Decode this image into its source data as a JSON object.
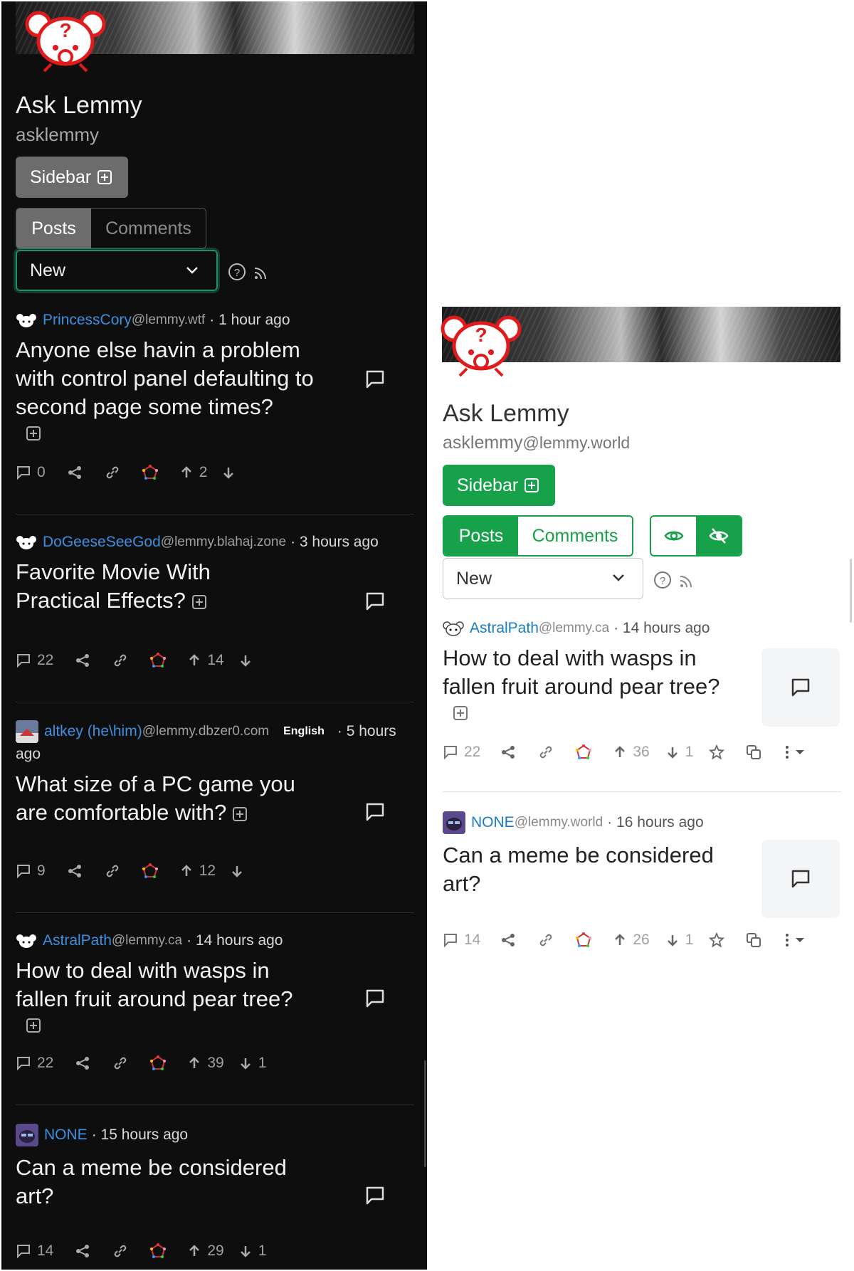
{
  "dark": {
    "community_title": "Ask Lemmy",
    "community_handle": "asklemmy",
    "sidebar_label": "Sidebar",
    "tabs": [
      "Posts",
      "Comments"
    ],
    "sort_value": "New",
    "posts": [
      {
        "user": "PrincessCory",
        "instance": "@lemmy.wtf",
        "time": "· 1 hour ago",
        "title": "Anyone else havin a problem with control panel defaulting to second page some times?",
        "comments": "0",
        "score": "2",
        "downs": ""
      },
      {
        "user": "DoGeeseSeeGod",
        "instance": "@lemmy.blahaj.zone",
        "time": "· 3 hours ago",
        "title": "Favorite Movie With Practical Effects?",
        "comments": "22",
        "score": "14",
        "downs": ""
      },
      {
        "user": "altkey (he\\him)",
        "instance": "@lemmy.dbzer0.com",
        "lang": "English",
        "time": "· 5 hours",
        "time2": "ago",
        "title": "What size of a PC game you are comfortable with?",
        "comments": "9",
        "score": "12",
        "downs": ""
      },
      {
        "user": "AstralPath",
        "instance": "@lemmy.ca",
        "time": "· 14 hours ago",
        "title": "How to deal with wasps in fallen fruit around pear tree?",
        "comments": "22",
        "score": "39",
        "downs": "1"
      },
      {
        "user": "NONE",
        "instance": "",
        "time": "· 15 hours ago",
        "title": "Can a meme be considered art?",
        "comments": "14",
        "score": "29",
        "downs": "1"
      }
    ]
  },
  "light": {
    "community_title": "Ask Lemmy",
    "community_handle": "asklemmy",
    "community_instance": "@lemmy.world",
    "sidebar_label": "Sidebar",
    "tabs": [
      "Posts",
      "Comments"
    ],
    "sort_value": "New",
    "posts": [
      {
        "user": "AstralPath",
        "instance": "@lemmy.ca",
        "time": "· 14 hours ago",
        "title": "How to deal with wasps in fallen fruit around pear tree?",
        "comments": "22",
        "score": "36",
        "downs": "1"
      },
      {
        "user": "NONE",
        "instance": "@lemmy.world",
        "time": "· 16 hours ago",
        "title": "Can a meme be considered art?",
        "comments": "14",
        "score": "26",
        "downs": "1"
      }
    ]
  },
  "colors": {
    "accent_green": "#17a14a",
    "link_blue": "#3d8fe0",
    "dark_bg": "#0e0e0e"
  }
}
